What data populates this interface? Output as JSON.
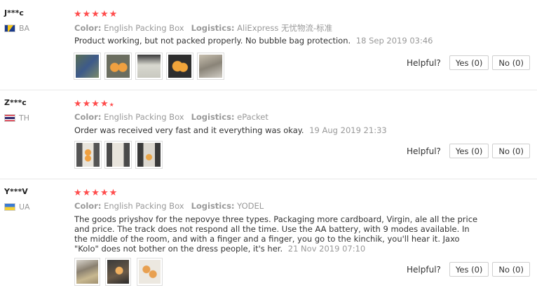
{
  "helpful_label": "Helpful?",
  "color_label": "Color:",
  "logistics_label": "Logistics:",
  "reviews": [
    {
      "user": "J***c",
      "country": "BA",
      "flag": "bosnia-flag",
      "stars": 5,
      "color": "English Packing Box",
      "logistics": "AliExpress 无忧物流-标准",
      "text": "Product working, but not packed properly. No bubble bag protection.",
      "date": "18 Sep 2019 03:46",
      "yes": "Yes (0)",
      "no": "No (0)",
      "photos": 5
    },
    {
      "user": "Z***c",
      "country": "TH",
      "flag": "thailand-flag",
      "stars": 4.5,
      "color": "English Packing Box",
      "logistics": "ePacket",
      "text": "Order was received very fast and it everything was okay.",
      "date": "19 Aug 2019 21:33",
      "yes": "Yes (0)",
      "no": "No (0)",
      "photos": 3
    },
    {
      "user": "Y***V",
      "country": "UA",
      "flag": "ukraine-flag",
      "stars": 5,
      "color": "English Packing Box",
      "logistics": "YODEL",
      "text": "The goods priyshov for the nepovye three types. Packaging more cardboard, Virgin, ale all the price and price. The track does not respond all the time. Use the AA battery, with 9 modes available. In the middle of the room, and with a finger and a finger, you go to the kinchik, you'll hear it. Jaxo \"Kolo\" does not bother on the dress people, it's her.",
      "date": "21 Nov 2019 07:10",
      "yes": "Yes (0)",
      "no": "No (0)",
      "photos": 3
    }
  ]
}
